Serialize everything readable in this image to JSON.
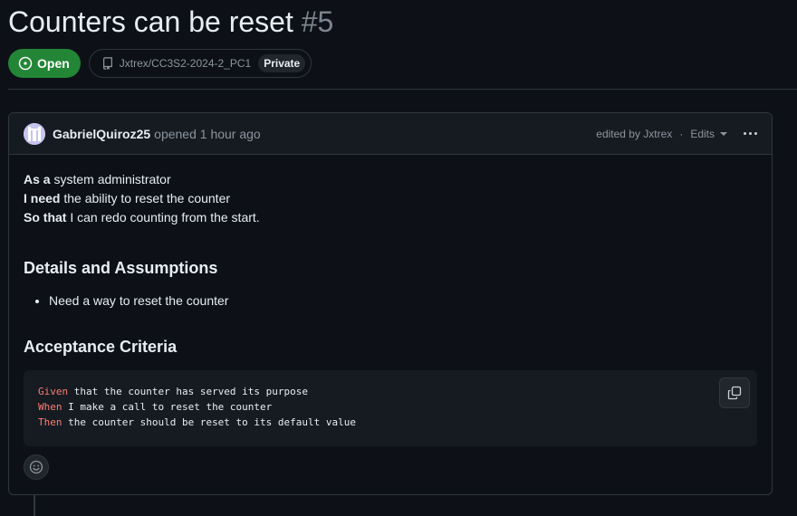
{
  "issue": {
    "title": "Counters can be reset",
    "number": "#5",
    "state": "Open",
    "repo": "Jxtrex/CC3S2-2024-2_PC1",
    "visibility": "Private"
  },
  "comment": {
    "author": "GabrielQuiroz25",
    "opened_text": "opened 1 hour ago",
    "edited_text": "edited by Jxtrex",
    "separator": "·",
    "edits_label": "Edits",
    "story": {
      "as_label": "As a",
      "as_text": " system administrator",
      "need_label": "I need",
      "need_text": " the ability to reset the counter",
      "so_label": "So that",
      "so_text": " I can redo counting from the start."
    },
    "details_heading": "Details and Assumptions",
    "details_items": [
      "Need a way to reset the counter"
    ],
    "criteria_heading": "Acceptance Criteria",
    "criteria_code": [
      {
        "keyword": "Given",
        "text": " that the counter has served its purpose"
      },
      {
        "keyword": "When",
        "text": " I make a call to reset the counter"
      },
      {
        "keyword": "Then",
        "text": " the counter should be reset to its default value"
      }
    ]
  },
  "colors": {
    "background": "#0d1117",
    "open_green": "#238636",
    "border": "#30363d",
    "muted": "#8b949e",
    "keyword_red": "#ff7b72"
  }
}
